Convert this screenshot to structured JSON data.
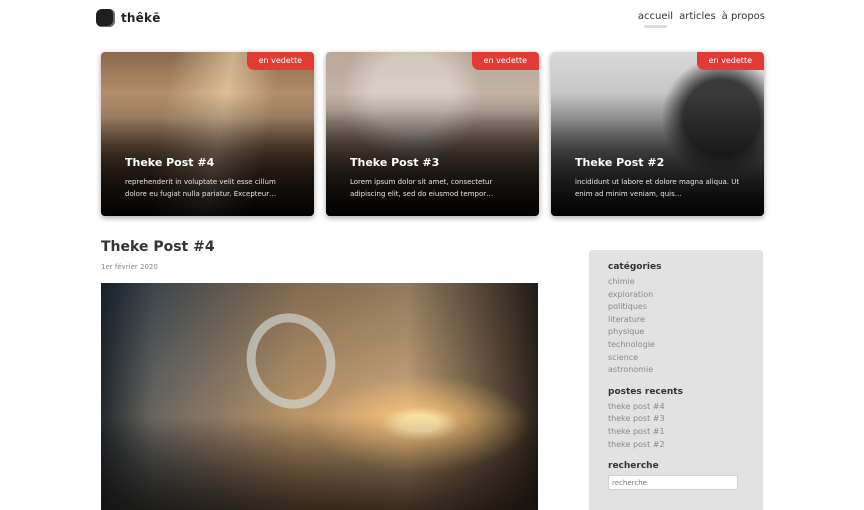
{
  "header": {
    "logo_text": "thêkē",
    "nav": [
      {
        "label": "accueil",
        "active": true
      },
      {
        "label": "articles",
        "active": false
      },
      {
        "label": "à propos",
        "active": false
      }
    ]
  },
  "featured": [
    {
      "badge": "en vedette",
      "title": "Theke Post #4",
      "excerpt": "reprehenderit in voluptate velit esse cillum dolore eu fugiat nulla pariatur. Excepteur…"
    },
    {
      "badge": "en vedette",
      "title": "Theke Post #3",
      "excerpt": "Lorem ipsum dolor sit amet, consectetur adipiscing elit, sed do eiusmod tempor…"
    },
    {
      "badge": "en vedette",
      "title": "Theke Post #2",
      "excerpt": "incididunt ut labore et dolore magna aliqua. Ut enim ad minim veniam, quis…"
    }
  ],
  "post": {
    "title": "Theke Post #4",
    "date": "1er février 2020"
  },
  "sidebar": {
    "categories_heading": "catégories",
    "categories": [
      "chimie",
      "exploration",
      "politiques",
      "literature",
      "physique",
      "technologie",
      "science",
      "astronomie"
    ],
    "recent_heading": "postes recents",
    "recent": [
      "theke post #4",
      "theke post #3",
      "theke post #1",
      "theke post #2"
    ],
    "search_heading": "recherche",
    "search_placeholder": "recherche"
  },
  "colors": {
    "badge": "#e23b36",
    "sidebar_bg": "#e2e2e2"
  }
}
